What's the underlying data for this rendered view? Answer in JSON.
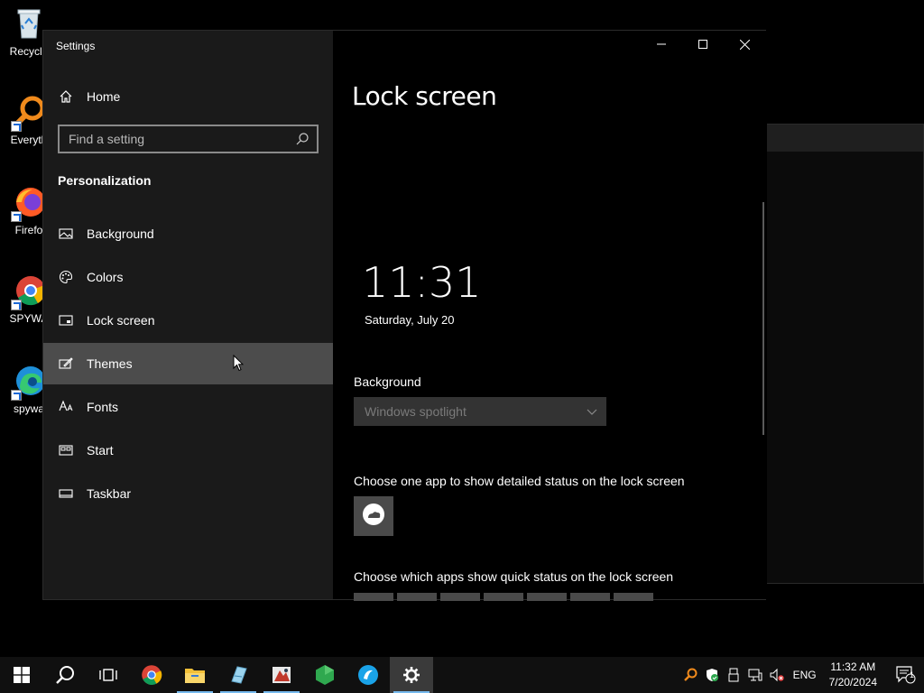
{
  "desktop": {
    "icons": [
      {
        "label": "Recycle",
        "name": "recycle-bin"
      },
      {
        "label": "Everyth",
        "name": "everything"
      },
      {
        "label": "Firefo",
        "name": "firefox"
      },
      {
        "label": "SPYWA",
        "name": "chrome-spyware"
      },
      {
        "label": "spywa",
        "name": "edge-spyware"
      }
    ]
  },
  "window": {
    "app_title": "Settings",
    "home_label": "Home",
    "search_placeholder": "Find a setting",
    "section_title": "Personalization",
    "nav_items": [
      {
        "label": "Background",
        "icon": "picture-icon"
      },
      {
        "label": "Colors",
        "icon": "palette-icon"
      },
      {
        "label": "Lock screen",
        "icon": "lock-screen-icon"
      },
      {
        "label": "Themes",
        "icon": "themes-icon"
      },
      {
        "label": "Fonts",
        "icon": "fonts-icon"
      },
      {
        "label": "Start",
        "icon": "start-icon"
      },
      {
        "label": "Taskbar",
        "icon": "taskbar-icon"
      }
    ],
    "hovered_item": "Themes"
  },
  "main": {
    "title": "Lock screen",
    "preview_time": "11:31",
    "preview_date": "Saturday, July 20",
    "background_label": "Background",
    "background_value": "Windows spotlight",
    "detail_label": "Choose one app to show detailed status on the lock screen",
    "quick_label": "Choose which apps show quick status on the lock screen",
    "quick_slot_count": 7
  },
  "taskbar": {
    "apps": [
      "start-button",
      "search-button",
      "task-view-button",
      "chrome",
      "file-explorer",
      "notepad-app",
      "paint-app",
      "shield-app",
      "browser-app",
      "settings"
    ],
    "active_app": "settings",
    "language": "ENG",
    "time": "11:32 AM",
    "date": "7/20/2024",
    "notification_count": "1"
  },
  "colors": {
    "accent": "#76b9ed",
    "nav_bg": "#1a1a1a",
    "hover_bg": "#4c4c4c"
  }
}
